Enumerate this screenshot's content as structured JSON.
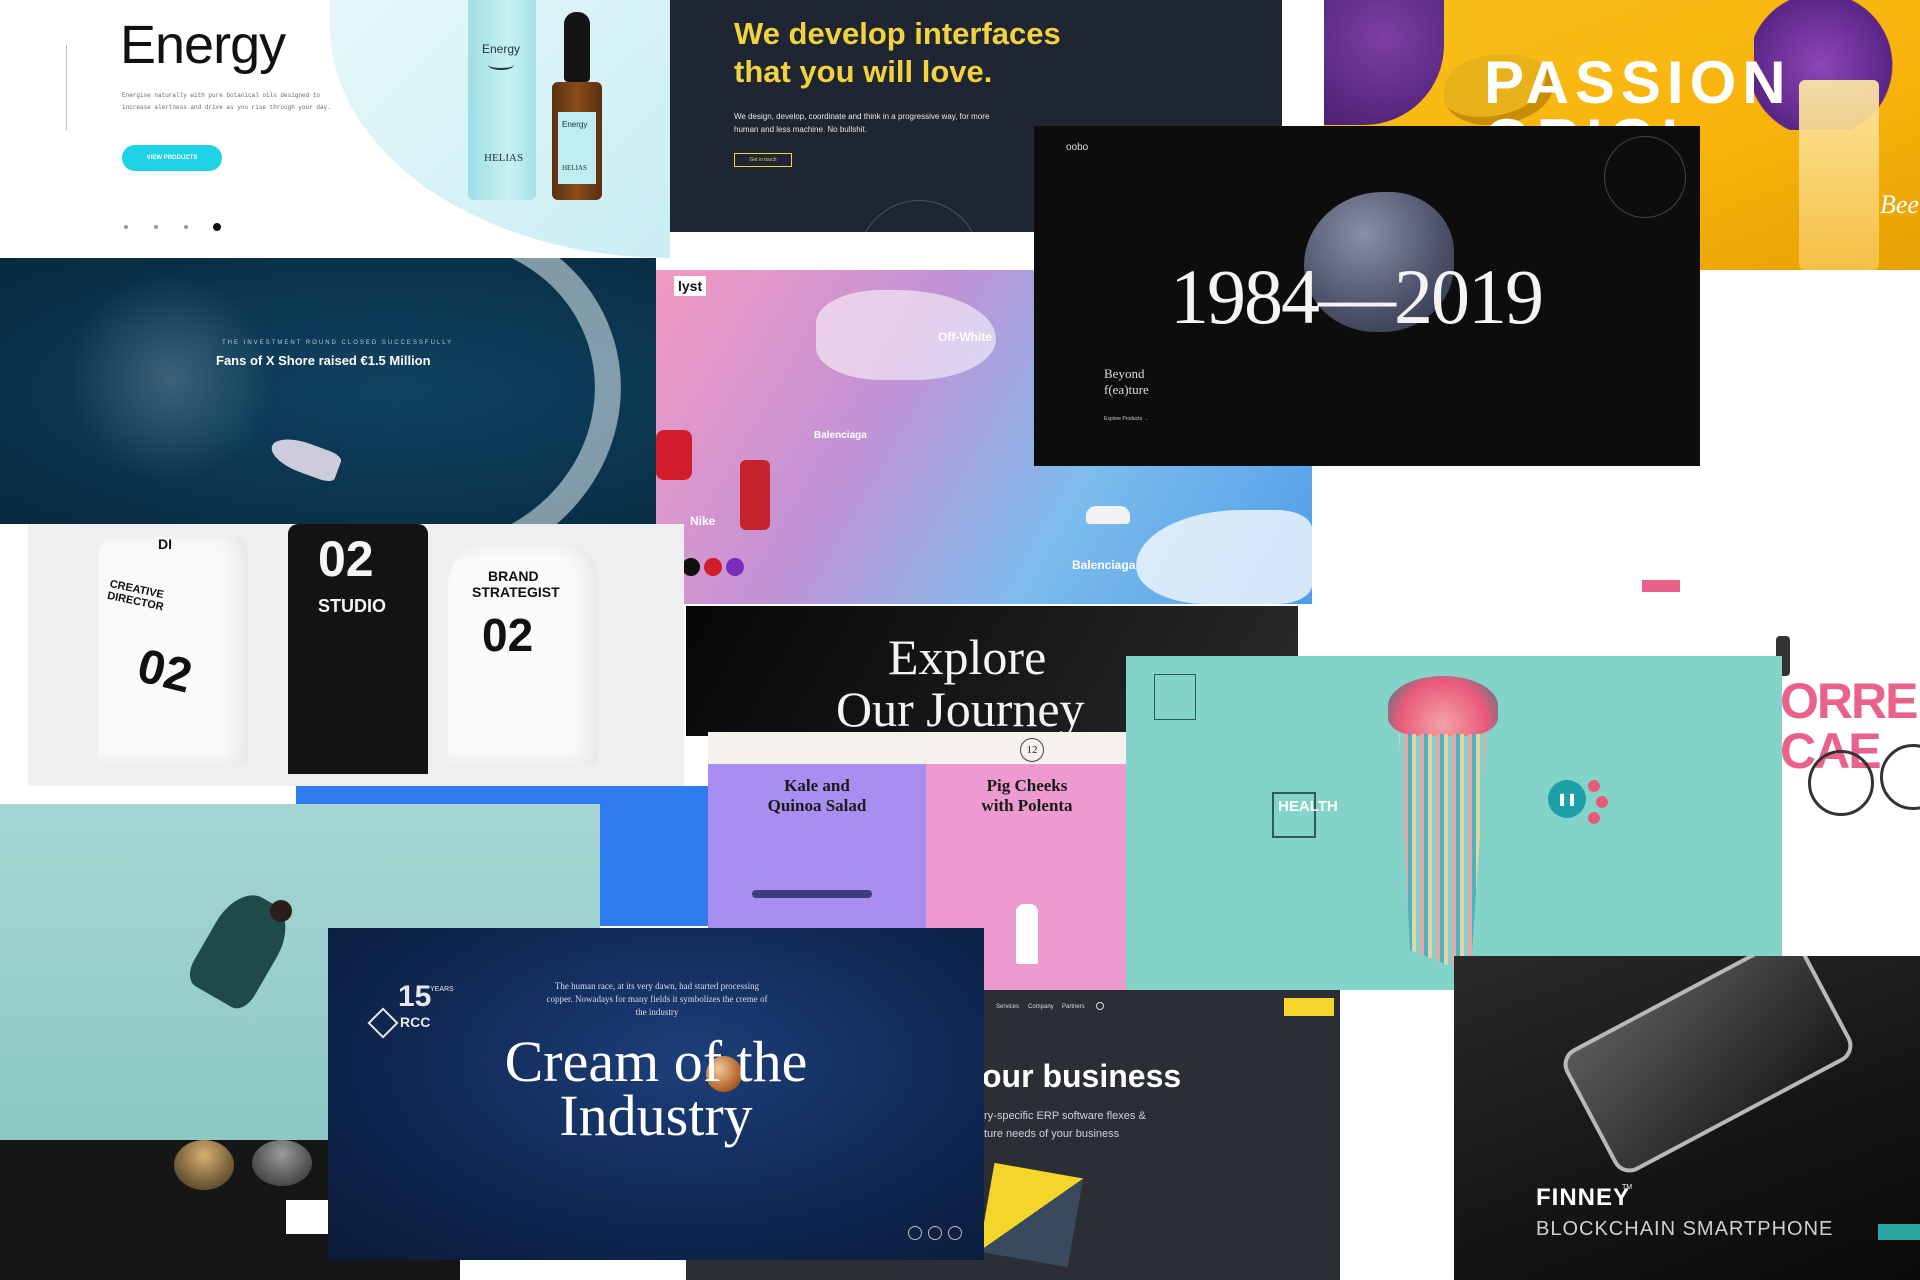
{
  "energy": {
    "title": "Energy",
    "body": "Energise naturally with pure botanical oils designed to increase alertness and drive as you rise through your day.",
    "button": "VIEW PRODUCTS",
    "bottle_label": "Energy",
    "bottle_brand": "HELIAS",
    "dropper_label": "Energy",
    "dropper_brand": "HELIAS"
  },
  "interfaces": {
    "headline_line1": "We develop interfaces",
    "headline_line2": "that you will love.",
    "body": "We design, develop, coordinate and think in a progressive way, for more human and less machine. No bullshit.",
    "button": "Get in touch"
  },
  "passion": {
    "headline": "PASSION",
    "headline2": "ORIGI",
    "side_text": "Bee"
  },
  "anniversary": {
    "brand": "oobo",
    "years": "1984—2019",
    "tagline_line1": "Beyond",
    "tagline_line2": "f(ea)ture",
    "link": "Explore Products →"
  },
  "xshore": {
    "kicker": "THE INVESTMENT ROUND CLOSED SUCCESSFULLY",
    "headline": "Fans of X Shore raised €1.5 Million"
  },
  "lyst": {
    "logo": "lyst",
    "labels": [
      "Off-White",
      "Balenciaga",
      "Nike",
      "Balenciaga"
    ]
  },
  "studio_shirts": {
    "shirt1_top": "DI",
    "shirt1_text": "CREATIVE DIRECTOR",
    "shirt1_number": "02",
    "shirt2_number": "02",
    "shirt2_text": "STUDIO",
    "shirt3_text_line1": "BRAND",
    "shirt3_text_line2": "STRATEGIST",
    "shirt3_number": "02"
  },
  "journey": {
    "line1": "Explore",
    "line2": "Our Journey"
  },
  "recipes": {
    "badge": "12",
    "card1_title_line1": "Kale and",
    "card1_title_line2": "Quinoa Salad",
    "card2_title_line1": "Pig Cheeks",
    "card2_title_line2": "with Polenta"
  },
  "jellyfish": {
    "health_label": "HEALTH",
    "colors": {
      "background": "#84d3c8",
      "accent": "#e95a7a"
    }
  },
  "cycling": {
    "big_text_line1": "ORRE",
    "big_text_line2": "CAE"
  },
  "cream": {
    "badge_number": "15",
    "badge_years": "YEARS",
    "badge_brand": "RCC",
    "intro": "The human race, at its very dawn, had started processing copper. Nowadays for many fields it symbolizes the creme of the industry",
    "title_line1": "Cream of the",
    "title_line2": "Industry"
  },
  "erp": {
    "nav": [
      "Services",
      "Company",
      "Partners"
    ],
    "headline": "our business",
    "body_line1": "ry-specific ERP software flexes &",
    "body_line2": "ture needs of your business"
  },
  "finney": {
    "brand": "FINNEY",
    "trademark": "TM",
    "subtitle": "BLOCKCHAIN SMARTPHONE"
  }
}
